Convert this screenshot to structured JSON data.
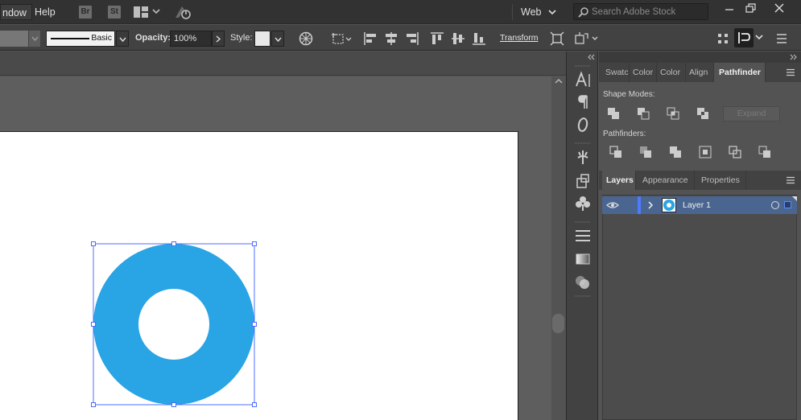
{
  "menubar": {
    "window_label": "ndow",
    "help_label": "Help",
    "br_badge": "Br",
    "st_badge": "St",
    "workspace_label": "Web",
    "search_placeholder": "Search Adobe Stock"
  },
  "controlbar": {
    "stroke_profile": "Basic",
    "opacity_label": "Opacity:",
    "opacity_value": "100%",
    "style_label": "Style:",
    "transform_label": "Transform"
  },
  "panels": {
    "top_tabs": [
      "Swatc",
      "Color",
      "Color",
      "Align",
      "Pathfinder"
    ],
    "active_top_tab": "Pathfinder",
    "pathfinder": {
      "shape_modes_label": "Shape Modes:",
      "expand_label": "Expand",
      "pathfinders_label": "Pathfinders:"
    },
    "bottom_tabs": [
      "Layers",
      "Appearance",
      "Properties"
    ],
    "active_bottom_tab": "Layers",
    "layers": [
      {
        "name": "Layer 1",
        "color": "#4c7bff"
      }
    ]
  },
  "artwork": {
    "shape": "ring",
    "fill": "#29a4e4",
    "selection_color": "#4c6dff"
  }
}
